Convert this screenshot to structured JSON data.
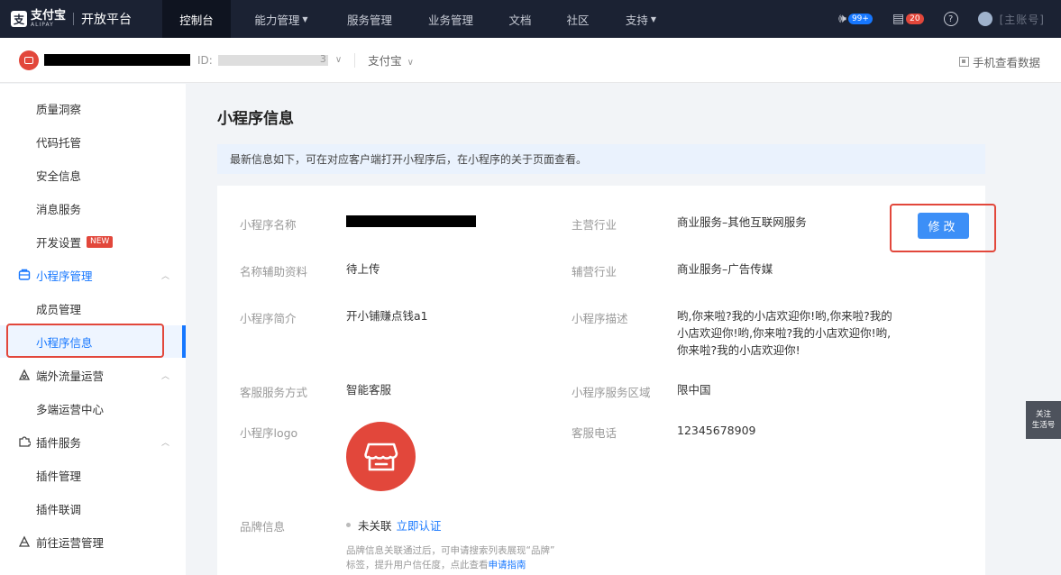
{
  "topnav": {
    "brand_cn": "支付宝",
    "brand_en": "ALIPAY",
    "platform": "开放平台",
    "items": [
      {
        "label": "控制台",
        "active": true,
        "caret": false
      },
      {
        "label": "能力管理",
        "active": false,
        "caret": true
      },
      {
        "label": "服务管理",
        "active": false,
        "caret": false
      },
      {
        "label": "业务管理",
        "active": false,
        "caret": false
      },
      {
        "label": "文档",
        "active": false,
        "caret": false
      },
      {
        "label": "社区",
        "active": false,
        "caret": false
      },
      {
        "label": "支持",
        "active": false,
        "caret": true
      }
    ],
    "speaker_icon": "speaker-icon",
    "notice_badge": "99+",
    "task_icon": "clipboard-icon",
    "task_badge": "20",
    "help_icon": "question-icon",
    "account_suffix": "[主账号]"
  },
  "appbar": {
    "id_label": "ID:",
    "id_tail": "3",
    "client": "支付宝",
    "mobile_data": "手机查看数据"
  },
  "sidebar": {
    "items": [
      {
        "label": "质量洞察",
        "kind": "sub"
      },
      {
        "label": "代码托管",
        "kind": "sub"
      },
      {
        "label": "安全信息",
        "kind": "sub"
      },
      {
        "label": "消息服务",
        "kind": "sub"
      },
      {
        "label": "开发设置",
        "kind": "sub",
        "tag": "NEW"
      },
      {
        "label": "小程序管理",
        "kind": "group",
        "icon": "miniapp-icon",
        "color": "blue"
      },
      {
        "label": "成员管理",
        "kind": "sub"
      },
      {
        "label": "小程序信息",
        "kind": "sub",
        "active": true
      },
      {
        "label": "端外流量运营",
        "kind": "group",
        "icon": "traffic-icon"
      },
      {
        "label": "多端运营中心",
        "kind": "sub"
      },
      {
        "label": "插件服务",
        "kind": "group",
        "icon": "plugin-icon"
      },
      {
        "label": "插件管理",
        "kind": "sub"
      },
      {
        "label": "插件联调",
        "kind": "sub"
      },
      {
        "label": "前往运营管理",
        "kind": "group",
        "icon": "operation-icon",
        "chev": false
      }
    ]
  },
  "main": {
    "title": "小程序信息",
    "notice": "最新信息如下，可在对应客户端打开小程序后，在小程序的关于页面查看。",
    "edit_label": "修改",
    "fields": {
      "name_label": "小程序名称",
      "industry_label": "主营行业",
      "industry_value": "商业服务–其他互联网服务",
      "aux_label": "名称辅助资料",
      "aux_value": "待上传",
      "sub_industry_label": "辅营行业",
      "sub_industry_value": "商业服务–广告传媒",
      "intro_label": "小程序简介",
      "intro_value": "开小铺赚点钱a1",
      "desc_label": "小程序描述",
      "desc_lines": [
        "哟,你来啦?我的小店欢迎你!哟,你来啦?我的",
        "小店欢迎你!哟,你来啦?我的小店欢迎你!哟,",
        "你来啦?我的小店欢迎你!"
      ],
      "cs_label": "客服服务方式",
      "cs_value": "智能客服",
      "region_label": "小程序服务区域",
      "region_value": "限中国",
      "logo_label": "小程序logo",
      "phone_label": "客服电话",
      "phone_value": "12345678909",
      "brand_label": "品牌信息",
      "brand_status": "未关联",
      "brand_link": "立即认证",
      "brand_tip_1": "品牌信息关联通过后，可申请搜索列表展现“品牌”",
      "brand_tip_2": "标签，提升用户信任度，点此查看",
      "brand_tip_link": "申请指南"
    }
  },
  "float": {
    "line1": "关注",
    "line2": "生活号"
  },
  "colors": {
    "accent": "#1677ff",
    "highlight": "#e2473b",
    "nav_bg": "#1b2233"
  }
}
